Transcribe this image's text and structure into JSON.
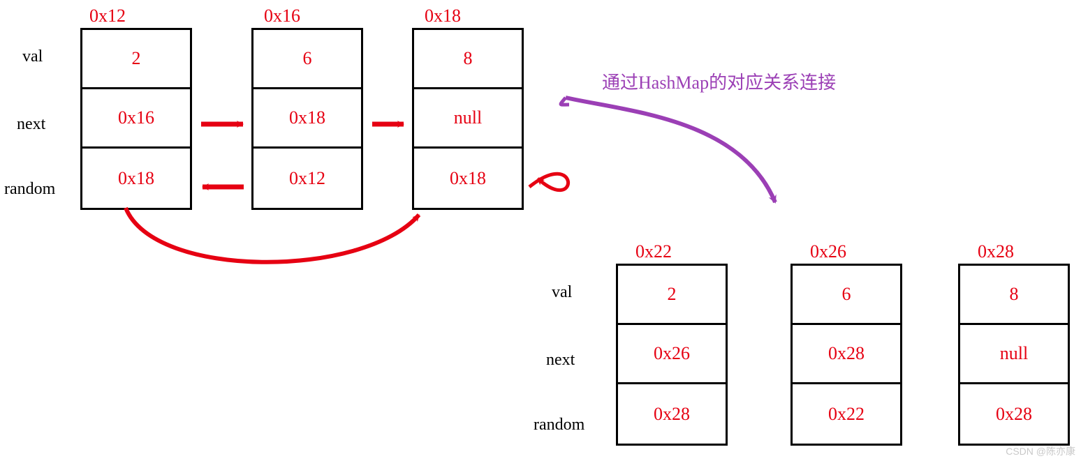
{
  "rowLabels": {
    "val": "val",
    "next": "next",
    "random": "random"
  },
  "annotation": "通过HashMap的对应关系连接",
  "watermark": "CSDN @陈亦康",
  "originalNodes": [
    {
      "addr": "0x12",
      "val": "2",
      "next": "0x16",
      "random": "0x18"
    },
    {
      "addr": "0x16",
      "val": "6",
      "next": "0x18",
      "random": "0x12"
    },
    {
      "addr": "0x18",
      "val": "8",
      "next": "null",
      "random": "0x18"
    }
  ],
  "copiedNodes": [
    {
      "addr": "0x22",
      "val": "2",
      "next": "0x26",
      "random": "0x28"
    },
    {
      "addr": "0x26",
      "val": "6",
      "next": "0x28",
      "random": "0x22"
    },
    {
      "addr": "0x28",
      "val": "8",
      "next": "null",
      "random": "0x28"
    }
  ]
}
